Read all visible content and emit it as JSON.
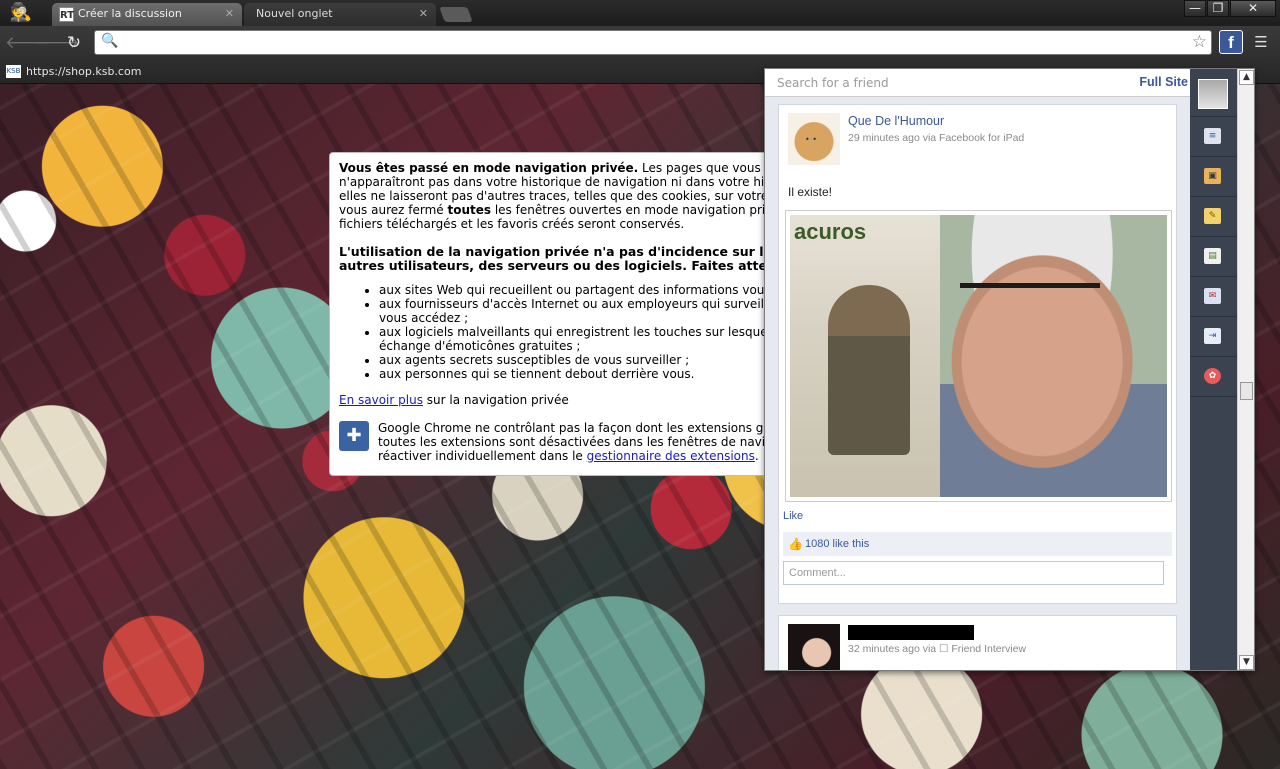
{
  "browser": {
    "tabs": [
      {
        "label": "Créer la discussion",
        "favicon": "RT"
      },
      {
        "label": "Nouvel onglet"
      }
    ],
    "window_buttons": [
      "—",
      "❐",
      "✕"
    ],
    "omnibox": {
      "value": "",
      "placeholder": ""
    },
    "bookmark": {
      "label": "https://shop.ksb.com",
      "icon_text": "KSB"
    }
  },
  "incognito": {
    "para1_bold": "Vous êtes passé en mode navigation privée.",
    "para1_text": " Les pages que vous consultez dans cette fenêtre n'apparaîtront pas dans votre historique de navigation ni dans votre historique de recherche, et elles ne laisseront pas d'autres traces, telles que des cookies, sur votre ordinateur une fois que vous aurez fermé ",
    "para1_bold2": "toutes",
    "para1_text2": " les fenêtres ouvertes en mode navigation privée. Toutefois, tous les fichiers téléchargés et les favoris créés seront conservés.",
    "heading": "L'utilisation de la navigation privée n'a pas d'incidence sur le comportement des autres utilisateurs, des serveurs ou des logiciels. Faites attention :",
    "bullets": [
      "aux sites Web qui recueillent ou partagent des informations vous concernant ;",
      "aux fournisseurs d'accès Internet ou aux employeurs qui surveillent les pages auxquelles vous accédez ;",
      "aux logiciels malveillants qui enregistrent les touches sur lesquelles vous appuyez en échange d'émoticônes gratuites ;",
      "aux agents secrets susceptibles de vous surveiller ;",
      "aux personnes qui se tiennent debout derrière vous."
    ],
    "learn_link": "En savoir plus",
    "learn_rest": " sur la navigation privée",
    "ext_text": "Google Chrome ne contrôlant pas la façon dont les extensions gèrent vos données personnelles, toutes les extensions sont désactivées dans les fenêtres de navigation privée. Vous pouvez les réactiver individuellement dans le ",
    "ext_link": "gestionnaire des extensions",
    "ext_end": "."
  },
  "facebook": {
    "search_placeholder": "Search for a friend",
    "full_site": "Full Site",
    "posts": [
      {
        "author": "Que De l'Humour",
        "meta": "29 minutes ago via Facebook for iPad",
        "text": "Il existe!",
        "like_link": "Like",
        "likes": "1080 like this",
        "comment_placeholder": "Comment..."
      },
      {
        "author": "",
        "meta": "32 minutes ago via ☐ Friend Interview"
      }
    ],
    "photo_text": "acuros",
    "rail_icons": [
      "news-feed-icon",
      "photos-icon",
      "notes-icon",
      "events-icon",
      "messages-icon",
      "logout-icon",
      "lollipop-icon"
    ]
  },
  "colors": {
    "facebook_blue": "#3b5998",
    "rail_bg": "#3b4250"
  }
}
